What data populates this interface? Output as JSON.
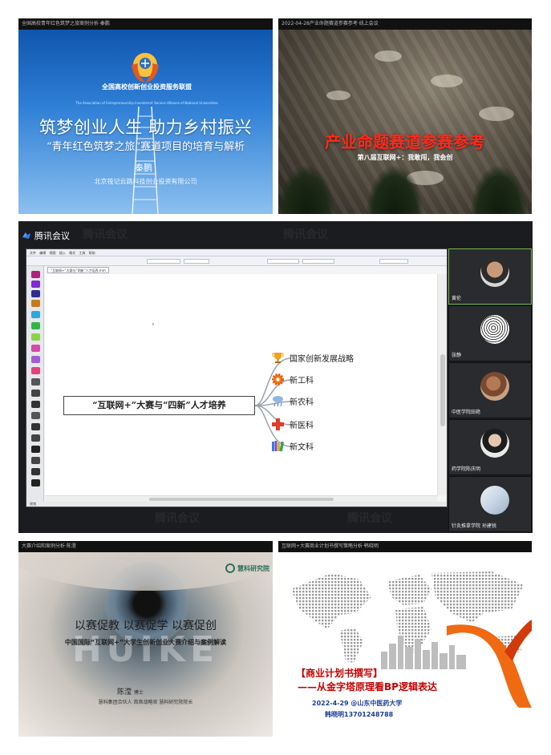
{
  "panel1": {
    "bar": "全国高校青年红色筑梦之旅案例分析·秦鹏",
    "org_name": "全国高校创新创业投资服务联盟",
    "org_en": "The Association of Entrepreneurship Investment Service Alliance of National Universities",
    "title": "筑梦创业人生  助力乡村振兴",
    "subtitle": "“青年红色筑梦之旅”赛道项目的培育与解析",
    "speaker": "秦鹏",
    "company": "北京筏记云路科技创业投资有限公司"
  },
  "panel2": {
    "bar": "2022-04-28产业命题赛道参赛参考·线上会议",
    "title": "产业命题赛道参赛参考",
    "subtitle": "第八届互联网+：我敢闯，我会创"
  },
  "panel3": {
    "app_name": "腾讯会议",
    "watermark": "腾讯会议",
    "editor": {
      "menu": "文件  编辑  视图  插入  格式  工具  帮助",
      "doc_tab": "“互联网+”大赛与“四新”人才培养.mm",
      "status": "就绪"
    },
    "mindmap": {
      "center": "“互联网+”大赛与“四新”人才培养",
      "branches": [
        {
          "label": "国家创新发展战略",
          "icon": "trophy-icon"
        },
        {
          "label": "新工科",
          "icon": "gear-icon"
        },
        {
          "label": "新农科",
          "icon": "cloud-rain-icon"
        },
        {
          "label": "新医科",
          "icon": "medical-cross-icon"
        },
        {
          "label": "新文科",
          "icon": "books-icon"
        }
      ]
    },
    "participants": [
      {
        "name": "黄伦",
        "active": true
      },
      {
        "name": "张静"
      },
      {
        "name": "中医学院田艳"
      },
      {
        "name": "药学院陈庆明"
      },
      {
        "name": "针灸推拿学院 孙建锐"
      }
    ]
  },
  "panel4": {
    "bar": "大赛介绍和案例分析·陈澄",
    "logo": "慧科研究院",
    "watermark": "HUIKE",
    "title": "以赛促教 以赛促学 以赛促创",
    "subtitle": "中国国际“互联网+”大学生创新创业大赛介绍与案例解读",
    "speaker": "陈滢",
    "speaker_title": "博士",
    "role": "慧科集团合伙人 首席战略官 慧科研究院院长"
  },
  "panel5": {
    "bar": "互联网+大赛商业计划书撰写策略分析·韩晓明",
    "title_line1": "【商业计划书撰写】",
    "title_line2": "——从金字塔原理看BP逻辑表达",
    "date": "2022-4-29 @山东中医药大学",
    "contact": "韩晓明13701248788"
  },
  "colors": {
    "tencent_blue": "#2a7bf6",
    "red_title": "#ff2a1c",
    "navy_text": "#1c3d93"
  }
}
